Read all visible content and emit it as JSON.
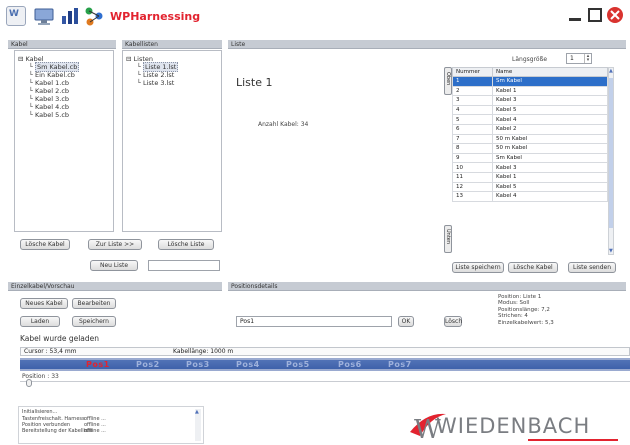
{
  "window": {
    "title": "WPHarnessing"
  },
  "colors": {
    "accent_red": "#e2232f",
    "selection_blue": "#2d6fc9",
    "position_bar": "#3a5ea8"
  },
  "icons": [
    "wiedenbach-w-icon",
    "monitor-icon",
    "chart-icon",
    "network-icon",
    "minimize-icon",
    "maximize-icon",
    "close-icon"
  ],
  "kabel_panel": {
    "header": "Kabel",
    "tree": {
      "root": "Kabel",
      "items": [
        "Sm Kabel.cb",
        "Ein Kabel.cb",
        "Kabel 1.cb",
        "Kabel 2.cb",
        "Kabel 3.cb",
        "Kabel 4.cb",
        "Kabel 5.cb"
      ],
      "selected_index": 0
    },
    "buttons": {
      "delete": "Lösche Kabel",
      "to_list": "Zur Liste >>",
      "neu_liste": "Neu Liste"
    }
  },
  "kabellisten_panel": {
    "header": "Kabellisten",
    "tree": {
      "root": "Listen",
      "items": [
        "Liste 1.lst",
        "Liste 2.lst",
        "Liste 3.lst"
      ],
      "selected_index": 0
    },
    "buttons": {
      "delete_list": "Lösche Liste"
    },
    "new_list_input": {
      "value": ""
    }
  },
  "liste_panel": {
    "header": "Liste",
    "title": "Liste 1",
    "count_label": "Anzahl Kabel: 34",
    "laengsgroesse": {
      "label": "Längsgröße",
      "value": "1"
    },
    "table": {
      "columns": [
        "Nummer",
        "Name"
      ],
      "rows": [
        [
          "1",
          "Sm Kabel"
        ],
        [
          "2",
          "Kabel 1"
        ],
        [
          "3",
          "Kabel 3"
        ],
        [
          "4",
          "Kabel 5"
        ],
        [
          "5",
          "Kabel 4"
        ],
        [
          "6",
          "Kabel 2"
        ],
        [
          "7",
          "50 m Kabel"
        ],
        [
          "8",
          "50 m Kabel"
        ],
        [
          "9",
          "Sm Kabel"
        ],
        [
          "10",
          "Kabel 3"
        ],
        [
          "11",
          "Kabel 1"
        ],
        [
          "12",
          "Kabel 5"
        ],
        [
          "13",
          "Kabel 4"
        ]
      ],
      "selected_row": 0
    },
    "side_buttons": {
      "up": "Oben",
      "down": "Unten"
    },
    "buttons": {
      "save": "Liste speichern",
      "delete_cable": "Lösche Kabel",
      "send": "Liste senden"
    }
  },
  "einzelkabel_panel": {
    "header": "Einzelkabel/Vorschau",
    "buttons": {
      "new_cable": "Neues Kabel",
      "edit": "Bearbeiten",
      "load": "Laden",
      "save": "Speichern"
    },
    "status_text": "Kabel wurde geladen",
    "cursor_label": "Cursor : 53,4 mm",
    "kabellaenge_label": "Kabellänge: 1000 m"
  },
  "position_panel": {
    "header": "Positionsdetails",
    "input_value": "Pos1",
    "buttons": {
      "ok": "OK",
      "delete": "Lösch"
    },
    "details": [
      "Position: Liste 1",
      "Modus: Soll",
      "Positionslänge: 7,2",
      "Strichen: 4",
      "Einzelkabelwert: 5,3"
    ]
  },
  "position_bar": {
    "labels": [
      "Pos1",
      "Pos2",
      "Pos3",
      "Pos4",
      "Pos5",
      "Pos6",
      "Pos7"
    ],
    "active_index": 0
  },
  "position_readout": "Position : 33",
  "log": {
    "heading": "Initialisieren...",
    "lines": [
      [
        "Tastenfreischalt. Harness",
        "offline ... "
      ],
      [
        "Position verbunden",
        "offline ... "
      ],
      [
        "Bereitstellung der Kabelliste",
        "offline ... "
      ]
    ]
  },
  "brand": {
    "logo_text": "WIEDENBACH"
  }
}
